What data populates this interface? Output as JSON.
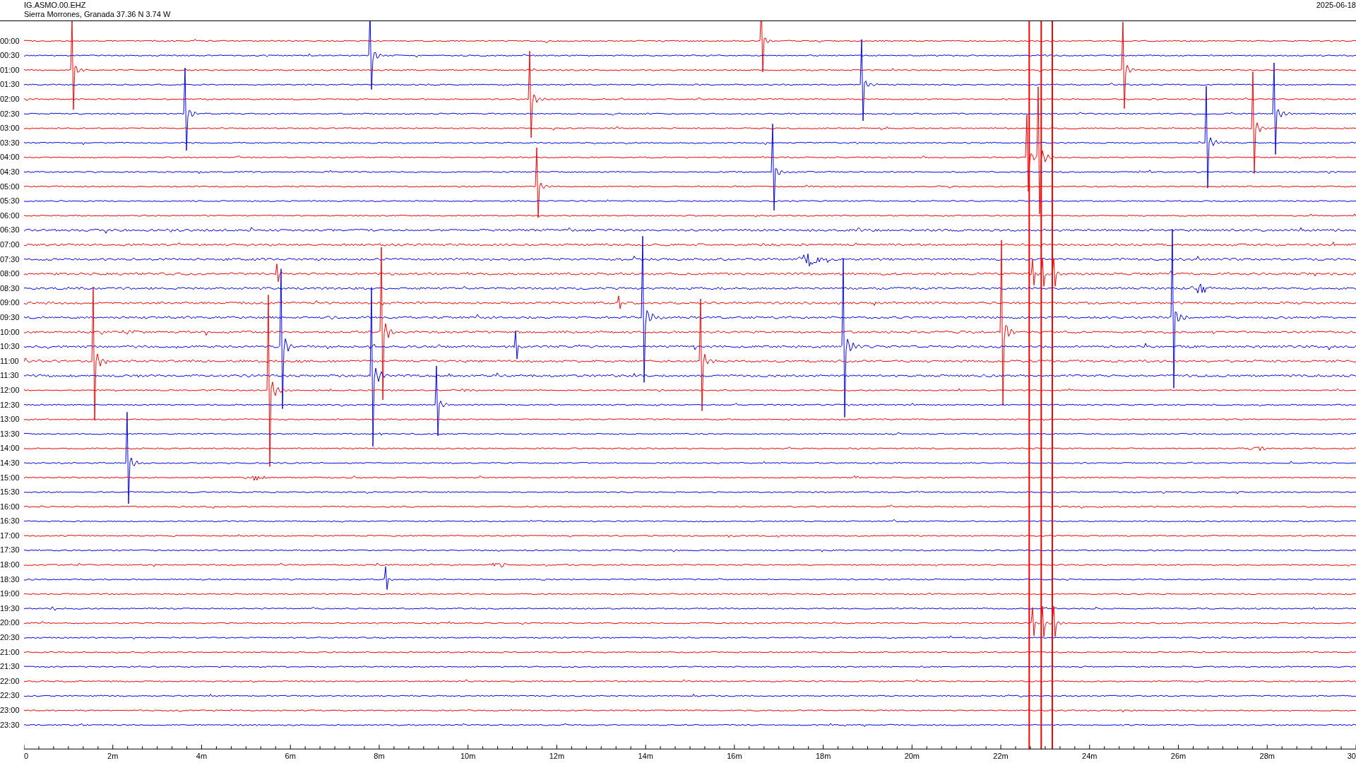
{
  "header": {
    "station": "IG.ASMO.00.EHZ",
    "location": "Sierra Morrones, Granada  37.36 N 3.74 W",
    "date": "2025-06-18"
  },
  "rows": [
    {
      "time": "00:00"
    },
    {
      "time": "00:30"
    },
    {
      "time": "01:00"
    },
    {
      "time": "01:30"
    },
    {
      "time": "02:00"
    },
    {
      "time": "02:30"
    },
    {
      "time": "03:00"
    },
    {
      "time": "03:30"
    },
    {
      "time": "04:00"
    },
    {
      "time": "04:30"
    },
    {
      "time": "05:00"
    },
    {
      "time": "05:30"
    },
    {
      "time": "06:00"
    },
    {
      "time": "06:30"
    },
    {
      "time": "07:00"
    },
    {
      "time": "07:30"
    },
    {
      "time": "08:00"
    },
    {
      "time": "08:30"
    },
    {
      "time": "09:00"
    },
    {
      "time": "09:30"
    },
    {
      "time": "10:00"
    },
    {
      "time": "10:30"
    },
    {
      "time": "11:00"
    },
    {
      "time": "11:30"
    },
    {
      "time": "12:00"
    },
    {
      "time": "12:30"
    },
    {
      "time": "13:00"
    },
    {
      "time": "13:30"
    },
    {
      "time": "14:00"
    },
    {
      "time": "14:30"
    },
    {
      "time": "15:00"
    },
    {
      "time": "15:30"
    },
    {
      "time": "16:00"
    },
    {
      "time": "16:30"
    },
    {
      "time": "17:00"
    },
    {
      "time": "17:30"
    },
    {
      "time": "18:00"
    },
    {
      "time": "18:30"
    },
    {
      "time": "19:00"
    },
    {
      "time": "19:30"
    },
    {
      "time": "20:00"
    },
    {
      "time": "20:30"
    },
    {
      "time": "21:00"
    },
    {
      "time": "21:30"
    },
    {
      "time": "22:00"
    },
    {
      "time": "22:30"
    },
    {
      "time": "23:00"
    },
    {
      "time": "23:30"
    }
  ],
  "time_axis": {
    "labels": [
      "0",
      "2m",
      "4m",
      "6m",
      "8m",
      "10m",
      "12m",
      "14m",
      "16m",
      "18m",
      "20m",
      "22m",
      "24m",
      "26m",
      "28m",
      "30"
    ]
  }
}
